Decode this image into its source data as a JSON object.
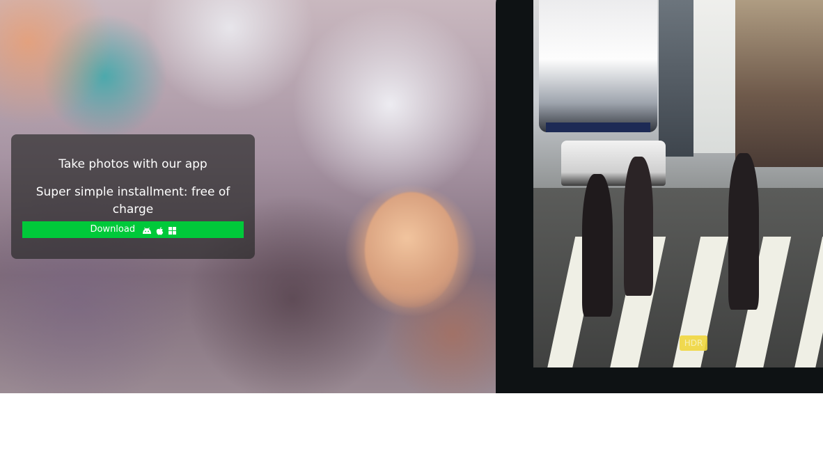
{
  "promo": {
    "title": "Take photos with our app",
    "subtitle": "Super simple installment: free of charge",
    "download_label": "Download",
    "platform_icons": [
      "android-icon",
      "apple-icon",
      "windows-icon"
    ],
    "button_color": "#00c93a"
  },
  "camera": {
    "hdr_badge": "HDR"
  }
}
